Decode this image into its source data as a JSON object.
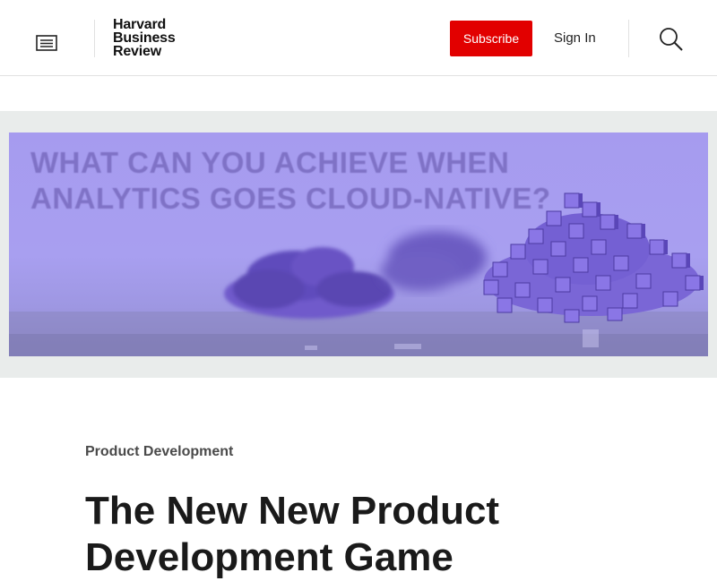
{
  "header": {
    "logo_line1": "Harvard",
    "logo_line2": "Business",
    "logo_line3": "Review",
    "subscribe_label": "Subscribe",
    "signin_label": "Sign In",
    "menu_icon": "menu-icon",
    "search_icon": "search-icon"
  },
  "ad": {
    "headline_line1": "WHAT CAN YOU ACHIEVE WHEN",
    "headline_line2": "ANALYTICS GOES CLOUD-NATIVE?"
  },
  "article": {
    "category": "Product Development",
    "title": "The New New Product Development Game"
  },
  "colors": {
    "subscribe_bg": "#e20000",
    "ad_bg": "#a69bef",
    "band_bg": "#e9eceb"
  }
}
